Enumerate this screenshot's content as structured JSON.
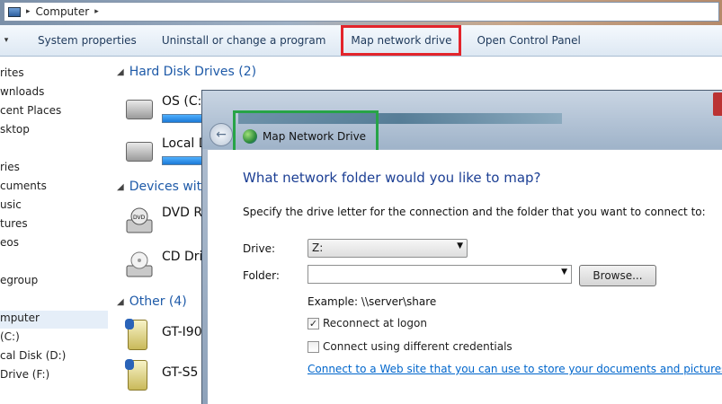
{
  "address": {
    "crumb": "Computer"
  },
  "toolbar": {
    "system_properties": "System properties",
    "uninstall": "Uninstall or change a program",
    "map_network_drive": "Map network drive",
    "open_control_panel": "Open Control Panel"
  },
  "nav": {
    "items": [
      "rites",
      "wnloads",
      "cent Places",
      "sktop",
      "ries",
      "cuments",
      "usic",
      "tures",
      "eos",
      "egroup",
      "mputer",
      "(C:)",
      "cal Disk (D:)",
      "Drive (F:)"
    ]
  },
  "content": {
    "hard_disk_group": "Hard Disk Drives (2)",
    "drive_os": "OS (C:)",
    "drive_local": "Local D",
    "removable_group": "Devices with",
    "drive_dvd": "DVD R",
    "drive_cd": "CD Dri",
    "other_group": "Other (4)",
    "phone1": "GT-I90",
    "phone2": "GT-S5"
  },
  "dialog": {
    "title": "Map Network Drive",
    "question": "What network folder would you like to map?",
    "instructions": "Specify the drive letter for the connection and the folder that you want to connect to:",
    "drive_label": "Drive:",
    "drive_value": "Z:",
    "folder_label": "Folder:",
    "folder_value": "",
    "browse_label": "Browse...",
    "example": "Example: \\\\server\\share",
    "reconnect_label": "Reconnect at logon",
    "reconnect_checked": true,
    "credentials_label": "Connect using different credentials",
    "credentials_checked": false,
    "link": "Connect to a Web site that you can use to store your documents and pictures"
  },
  "colors": {
    "highlight_red": "#e3242b",
    "highlight_green": "#27a447",
    "heading_blue": "#1c3f94",
    "link_blue": "#0066cc"
  }
}
